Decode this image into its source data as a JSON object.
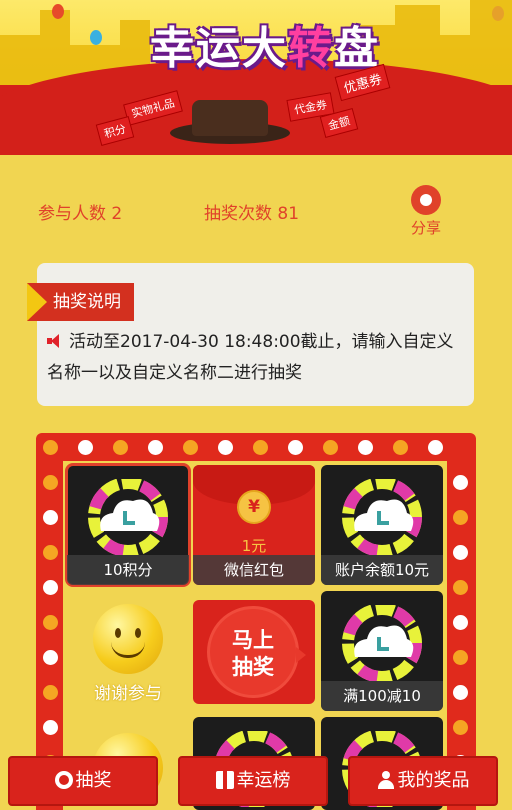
{
  "banner": {
    "title_part1": "幸运大",
    "title_part2": "转",
    "title_part3": "盘",
    "tags": [
      "实物礼品",
      "优惠券",
      "代金券",
      "积分",
      "金额"
    ]
  },
  "stats": {
    "participants_label": "参与人数 2",
    "draws_label": "抽奖次数 81",
    "share_label": "分享"
  },
  "info": {
    "ribbon_label": "抽奖说明",
    "notice_text": "活动至2017-04-30 18:48:00截止，请输入自定义名称一以及自定义名称二进行抽奖"
  },
  "prizes": {
    "p1": "10积分",
    "p2": "微信红包",
    "p2_amount": "1元",
    "p2_coin": "¥",
    "p3": "账户余额10元",
    "p4": "满100减10",
    "thanks": "谢谢参与",
    "start_line1": "马上",
    "start_line2": "抽奖"
  },
  "nav": {
    "draw": "抽奖",
    "ranking": "幸运榜",
    "my_prizes": "我的奖品"
  },
  "colors": {
    "background": "#f1d551",
    "accent_red": "#d9231c",
    "text_red": "#e0422a"
  }
}
